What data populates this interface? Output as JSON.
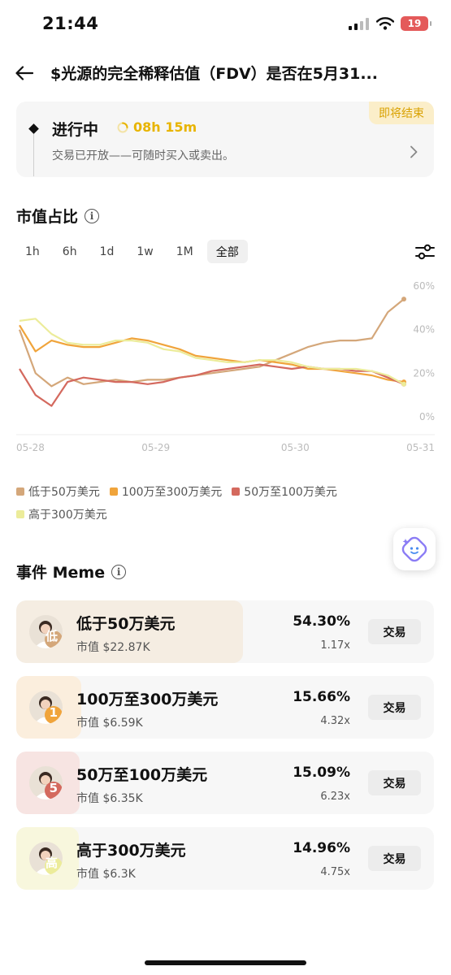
{
  "status_bar": {
    "time": "21:44",
    "battery": "19"
  },
  "header": {
    "title": "$光源的完全稀释估值（FDV）是否在5月31..."
  },
  "status_card": {
    "badge": "即将结束",
    "state": "进行中",
    "countdown": "08h 15m",
    "description": "交易已开放——可随时买入或卖出。"
  },
  "market_share": {
    "title": "市值占比",
    "ranges": [
      "1h",
      "6h",
      "1d",
      "1w",
      "1M",
      "全部"
    ],
    "active_range": "全部"
  },
  "chart_data": {
    "type": "line",
    "x_labels": [
      "05-28",
      "05-29",
      "05-30",
      "05-31"
    ],
    "y_ticks": [
      "0%",
      "20%",
      "40%",
      "60%"
    ],
    "ylim": [
      0,
      60
    ],
    "x_points": [
      "05-28",
      "05-28",
      "05-28",
      "05-28",
      "05-28",
      "05-28",
      "05-28",
      "05-28",
      "05-29",
      "05-29",
      "05-29",
      "05-29",
      "05-29",
      "05-29",
      "05-29",
      "05-29",
      "05-30",
      "05-30",
      "05-30",
      "05-30",
      "05-30",
      "05-30",
      "05-30",
      "05-30",
      "05-31"
    ],
    "series": [
      {
        "name": "低于50万美元",
        "color": "#d4a77a",
        "values": [
          40,
          20,
          14,
          18,
          15,
          16,
          17,
          16,
          17,
          17,
          18,
          19,
          20,
          21,
          22,
          23,
          26,
          29,
          32,
          34,
          35,
          35,
          36,
          48,
          54
        ]
      },
      {
        "name": "100万至300万美元",
        "color": "#f0a43b",
        "values": [
          42,
          30,
          35,
          33,
          32,
          32,
          34,
          36,
          35,
          33,
          31,
          28,
          27,
          26,
          25,
          26,
          25,
          24,
          22,
          22,
          21,
          20,
          19,
          17,
          16
        ]
      },
      {
        "name": "50万至100万美元",
        "color": "#d4695e",
        "values": [
          22,
          10,
          5,
          16,
          18,
          17,
          16,
          16,
          15,
          16,
          18,
          19,
          21,
          22,
          23,
          24,
          23,
          22,
          23,
          22,
          22,
          21,
          21,
          18,
          15
        ]
      },
      {
        "name": "高于300万美元",
        "color": "#ecec9a",
        "values": [
          44,
          45,
          38,
          34,
          33,
          33,
          35,
          35,
          34,
          31,
          30,
          27,
          26,
          25,
          25,
          26,
          26,
          25,
          23,
          22,
          22,
          22,
          21,
          19,
          15
        ]
      }
    ],
    "grid": false,
    "legend": "bottom"
  },
  "legend": [
    {
      "label": "低于50万美元",
      "color": "#d4a77a"
    },
    {
      "label": "100万至300万美元",
      "color": "#f0a43b"
    },
    {
      "label": "50万至100万美元",
      "color": "#d4695e"
    },
    {
      "label": "高于300万美元",
      "color": "#ecec9a"
    }
  ],
  "events": {
    "title": "事件 Meme",
    "trade_label": "交易",
    "mcap_prefix": "市值",
    "rows": [
      {
        "name": "低于50万美元",
        "mcap": "$22.87K",
        "pct": "54.30%",
        "mult": "1.17x",
        "share": 0.543,
        "avatar_letter": "低",
        "color": "#d4a77a",
        "tint": "#f5ede2"
      },
      {
        "name": "100万至300万美元",
        "mcap": "$6.59K",
        "pct": "15.66%",
        "mult": "4.32x",
        "share": 0.1566,
        "avatar_letter": "1",
        "color": "#f0a43b",
        "tint": "#fbeedd"
      },
      {
        "name": "50万至100万美元",
        "mcap": "$6.35K",
        "pct": "15.09%",
        "mult": "6.23x",
        "share": 0.1509,
        "avatar_letter": "5",
        "color": "#d4695e",
        "tint": "#f7e4e2"
      },
      {
        "name": "高于300万美元",
        "mcap": "$6.3K",
        "pct": "14.96%",
        "mult": "4.75x",
        "share": 0.1496,
        "avatar_letter": "高",
        "color": "#ecec9a",
        "tint": "#f8f7dd"
      }
    ]
  }
}
